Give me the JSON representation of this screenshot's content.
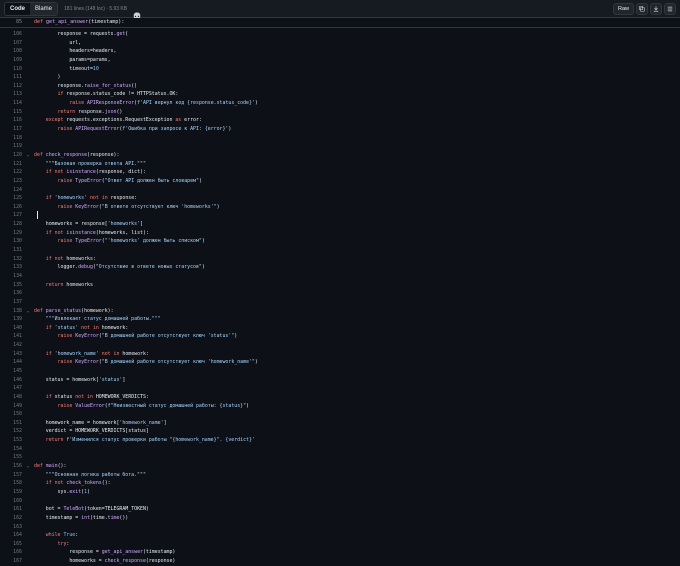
{
  "toolbar": {
    "code_label": "Code",
    "blame_label": "Blame",
    "file_meta": "181 lines (148 loc) · 5.93 KB",
    "raw_label": "Raw"
  },
  "sticky": {
    "line_number": "85",
    "text": "def get_api_answer(timestamp):"
  },
  "code_lines": [
    {
      "n": "106",
      "t": "        response = requests.get("
    },
    {
      "n": "107",
      "t": "            url,"
    },
    {
      "n": "108",
      "t": "            headers=headers,"
    },
    {
      "n": "109",
      "t": "            params=params,"
    },
    {
      "n": "110",
      "t": "            timeout=10"
    },
    {
      "n": "111",
      "t": "        )"
    },
    {
      "n": "112",
      "t": "        response.raise_for_status()"
    },
    {
      "n": "113",
      "t": "        if response.status_code != HTTPStatus.OK:"
    },
    {
      "n": "114",
      "t": "            raise APIResponseError(f'API вернул код {response.status_code}')"
    },
    {
      "n": "115",
      "t": "        return response.json()"
    },
    {
      "n": "116",
      "t": "    except requests.exceptions.RequestException as error:"
    },
    {
      "n": "117",
      "t": "        raise APIRequestError(f'Ошибка при запросе к API: {error}')"
    },
    {
      "n": "118",
      "t": ""
    },
    {
      "n": "119",
      "t": ""
    },
    {
      "n": "120",
      "t": "def check_response(response):",
      "fold": true
    },
    {
      "n": "121",
      "t": "    \"\"\"Базовая проверка ответа API.\"\"\""
    },
    {
      "n": "122",
      "t": "    if not isinstance(response, dict):"
    },
    {
      "n": "123",
      "t": "        raise TypeError(\"Ответ API должен быть словарем\")"
    },
    {
      "n": "124",
      "t": ""
    },
    {
      "n": "125",
      "t": "    if 'homeworks' not in response:"
    },
    {
      "n": "126",
      "t": "        raise KeyError(\"В ответе отсутствует ключ 'homeworks'\")"
    },
    {
      "n": "127",
      "t": ""
    },
    {
      "n": "128",
      "t": "    homeworks = response['homeworks']"
    },
    {
      "n": "129",
      "t": "    if not isinstance(homeworks, list):"
    },
    {
      "n": "130",
      "t": "        raise TypeError(\"'homeworks' должен быть списком\")"
    },
    {
      "n": "131",
      "t": ""
    },
    {
      "n": "132",
      "t": "    if not homeworks:"
    },
    {
      "n": "133",
      "t": "        logger.debug(\"Отсутствие в ответе новых статусов\")"
    },
    {
      "n": "134",
      "t": ""
    },
    {
      "n": "135",
      "t": "    return homeworks"
    },
    {
      "n": "136",
      "t": ""
    },
    {
      "n": "137",
      "t": ""
    },
    {
      "n": "138",
      "t": "def parse_status(homework):",
      "fold": true
    },
    {
      "n": "139",
      "t": "    \"\"\"Извлекает статус домашней работы.\"\"\""
    },
    {
      "n": "140",
      "t": "    if 'status' not in homework:"
    },
    {
      "n": "141",
      "t": "        raise KeyError(\"В домашней работе отсутствует ключ 'status'\")"
    },
    {
      "n": "142",
      "t": ""
    },
    {
      "n": "143",
      "t": "    if 'homework_name' not in homework:"
    },
    {
      "n": "144",
      "t": "        raise KeyError(\"В домашней работе отсутствует ключ 'homework_name'\")"
    },
    {
      "n": "145",
      "t": ""
    },
    {
      "n": "146",
      "t": "    status = homework['status']"
    },
    {
      "n": "147",
      "t": ""
    },
    {
      "n": "148",
      "t": "    if status not in HOMEWORK_VERDICTS:"
    },
    {
      "n": "149",
      "t": "        raise ValueError(f\"Неизвестный статус домашней работы: {status}\")"
    },
    {
      "n": "150",
      "t": ""
    },
    {
      "n": "151",
      "t": "    homework_name = homework['homework_name']"
    },
    {
      "n": "152",
      "t": "    verdict = HOMEWORK_VERDICTS[status]"
    },
    {
      "n": "153",
      "t": "    return f'Изменился статус проверки работы \"{homework_name}\". {verdict}'"
    },
    {
      "n": "154",
      "t": ""
    },
    {
      "n": "155",
      "t": ""
    },
    {
      "n": "156",
      "t": "def main():",
      "fold": true
    },
    {
      "n": "157",
      "t": "    \"\"\"Основная логика работы бота.\"\"\""
    },
    {
      "n": "158",
      "t": "    if not check_tokens():"
    },
    {
      "n": "159",
      "t": "        sys.exit(1)"
    },
    {
      "n": "160",
      "t": ""
    },
    {
      "n": "161",
      "t": "    bot = TeleBot(token=TELEGRAM_TOKEN)"
    },
    {
      "n": "162",
      "t": "    timestamp = int(time.time())"
    },
    {
      "n": "163",
      "t": ""
    },
    {
      "n": "164",
      "t": "    while True:"
    },
    {
      "n": "165",
      "t": "        try:"
    },
    {
      "n": "166",
      "t": "            response = get_api_answer(timestamp)"
    },
    {
      "n": "167",
      "t": "            homeworks = check_response(response)"
    }
  ]
}
